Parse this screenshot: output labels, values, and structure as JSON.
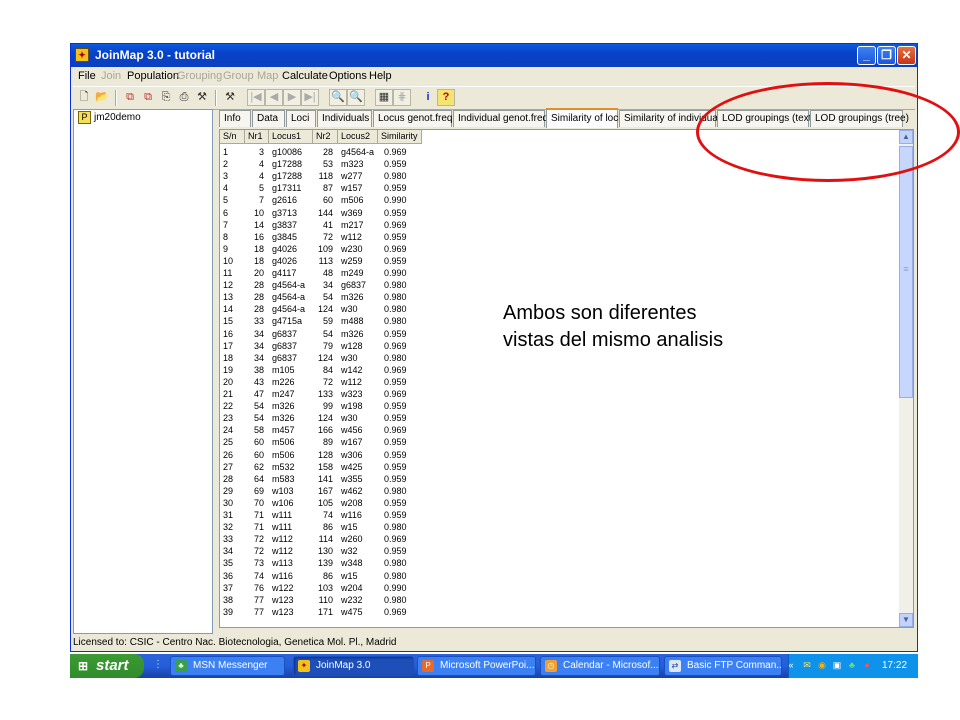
{
  "window": {
    "title": "JoinMap 3.0  -  tutorial",
    "min": "_",
    "max": "❐",
    "close": "✕"
  },
  "menu": {
    "file": "File",
    "join": "Join",
    "population": "Population",
    "grouping": "Grouping",
    "group": "Group",
    "map": "Map",
    "calculate": "Calculate",
    "options": "Options",
    "help": "Help"
  },
  "toolbar": {
    "info_label": "i",
    "help_label": "?"
  },
  "tree": {
    "root": "jm20demo",
    "root_icon": "P"
  },
  "tabs": [
    "Info",
    "Data",
    "Loci",
    "Individuals",
    "Locus genot.freq.",
    "Individual genot.freq.",
    "Similarity of loci",
    "Similarity of individuals",
    "LOD groupings (text)",
    "LOD groupings (tree)"
  ],
  "active_tab": "Similarity of loci",
  "table": {
    "headers": [
      "S/n",
      "Nr1",
      "Locus1",
      "Nr2",
      "Locus2",
      "Similarity"
    ],
    "rows": [
      [
        "1",
        "3",
        "g10086",
        "28",
        "g4564-a",
        "0.969"
      ],
      [
        "2",
        "4",
        "g17288",
        "53",
        "m323",
        "0.959"
      ],
      [
        "3",
        "4",
        "g17288",
        "118",
        "w277",
        "0.980"
      ],
      [
        "4",
        "5",
        "g17311",
        "87",
        "w157",
        "0.959"
      ],
      [
        "5",
        "7",
        "g2616",
        "60",
        "m506",
        "0.990"
      ],
      [
        "6",
        "10",
        "g3713",
        "144",
        "w369",
        "0.959"
      ],
      [
        "7",
        "14",
        "g3837",
        "41",
        "m217",
        "0.969"
      ],
      [
        "8",
        "16",
        "g3845",
        "72",
        "w112",
        "0.959"
      ],
      [
        "9",
        "18",
        "g4026",
        "109",
        "w230",
        "0.969"
      ],
      [
        "10",
        "18",
        "g4026",
        "113",
        "w259",
        "0.959"
      ],
      [
        "11",
        "20",
        "g4117",
        "48",
        "m249",
        "0.990"
      ],
      [
        "12",
        "28",
        "g4564-a",
        "34",
        "g6837",
        "0.980"
      ],
      [
        "13",
        "28",
        "g4564-a",
        "54",
        "m326",
        "0.980"
      ],
      [
        "14",
        "28",
        "g4564-a",
        "124",
        "w30",
        "0.980"
      ],
      [
        "15",
        "33",
        "g4715a",
        "59",
        "m488",
        "0.980"
      ],
      [
        "16",
        "34",
        "g6837",
        "54",
        "m326",
        "0.959"
      ],
      [
        "17",
        "34",
        "g6837",
        "79",
        "w128",
        "0.969"
      ],
      [
        "18",
        "34",
        "g6837",
        "124",
        "w30",
        "0.980"
      ],
      [
        "19",
        "38",
        "m105",
        "84",
        "w142",
        "0.969"
      ],
      [
        "20",
        "43",
        "m226",
        "72",
        "w112",
        "0.959"
      ],
      [
        "21",
        "47",
        "m247",
        "133",
        "w323",
        "0.969"
      ],
      [
        "22",
        "54",
        "m326",
        "99",
        "w198",
        "0.959"
      ],
      [
        "23",
        "54",
        "m326",
        "124",
        "w30",
        "0.959"
      ],
      [
        "24",
        "58",
        "m457",
        "166",
        "w456",
        "0.969"
      ],
      [
        "25",
        "60",
        "m506",
        "89",
        "w167",
        "0.959"
      ],
      [
        "26",
        "60",
        "m506",
        "128",
        "w306",
        "0.959"
      ],
      [
        "27",
        "62",
        "m532",
        "158",
        "w425",
        "0.959"
      ],
      [
        "28",
        "64",
        "m583",
        "141",
        "w355",
        "0.959"
      ],
      [
        "29",
        "69",
        "w103",
        "167",
        "w462",
        "0.980"
      ],
      [
        "30",
        "70",
        "w106",
        "105",
        "w208",
        "0.959"
      ],
      [
        "31",
        "71",
        "w111",
        "74",
        "w116",
        "0.959"
      ],
      [
        "32",
        "71",
        "w111",
        "86",
        "w15",
        "0.980"
      ],
      [
        "33",
        "72",
        "w112",
        "114",
        "w260",
        "0.969"
      ],
      [
        "34",
        "72",
        "w112",
        "130",
        "w32",
        "0.959"
      ],
      [
        "35",
        "73",
        "w113",
        "139",
        "w348",
        "0.980"
      ],
      [
        "36",
        "74",
        "w116",
        "86",
        "w15",
        "0.980"
      ],
      [
        "37",
        "76",
        "w122",
        "103",
        "w204",
        "0.990"
      ],
      [
        "38",
        "77",
        "w123",
        "110",
        "w232",
        "0.980"
      ],
      [
        "39",
        "77",
        "w123",
        "171",
        "w475",
        "0.969"
      ]
    ]
  },
  "status_bar": "Licensed to: CSIC - Centro Nac. Biotecnologia, Genetica Mol. Pl., Madrid",
  "taskbar": {
    "start": "start",
    "tasks": [
      "MSN Messenger",
      "JoinMap 3.0",
      "Microsoft PowerPoi...",
      "Calendar - Microsof...",
      "Basic FTP Comman..."
    ],
    "clock": "17:22"
  },
  "annotation": {
    "line1": "Ambos son diferentes",
    "line2": "vistas del mismo analisis"
  },
  "colors": {
    "highlight_ellipse": "#e01010",
    "titlebar": "#0a5ae0",
    "taskbar": "#245edb"
  }
}
